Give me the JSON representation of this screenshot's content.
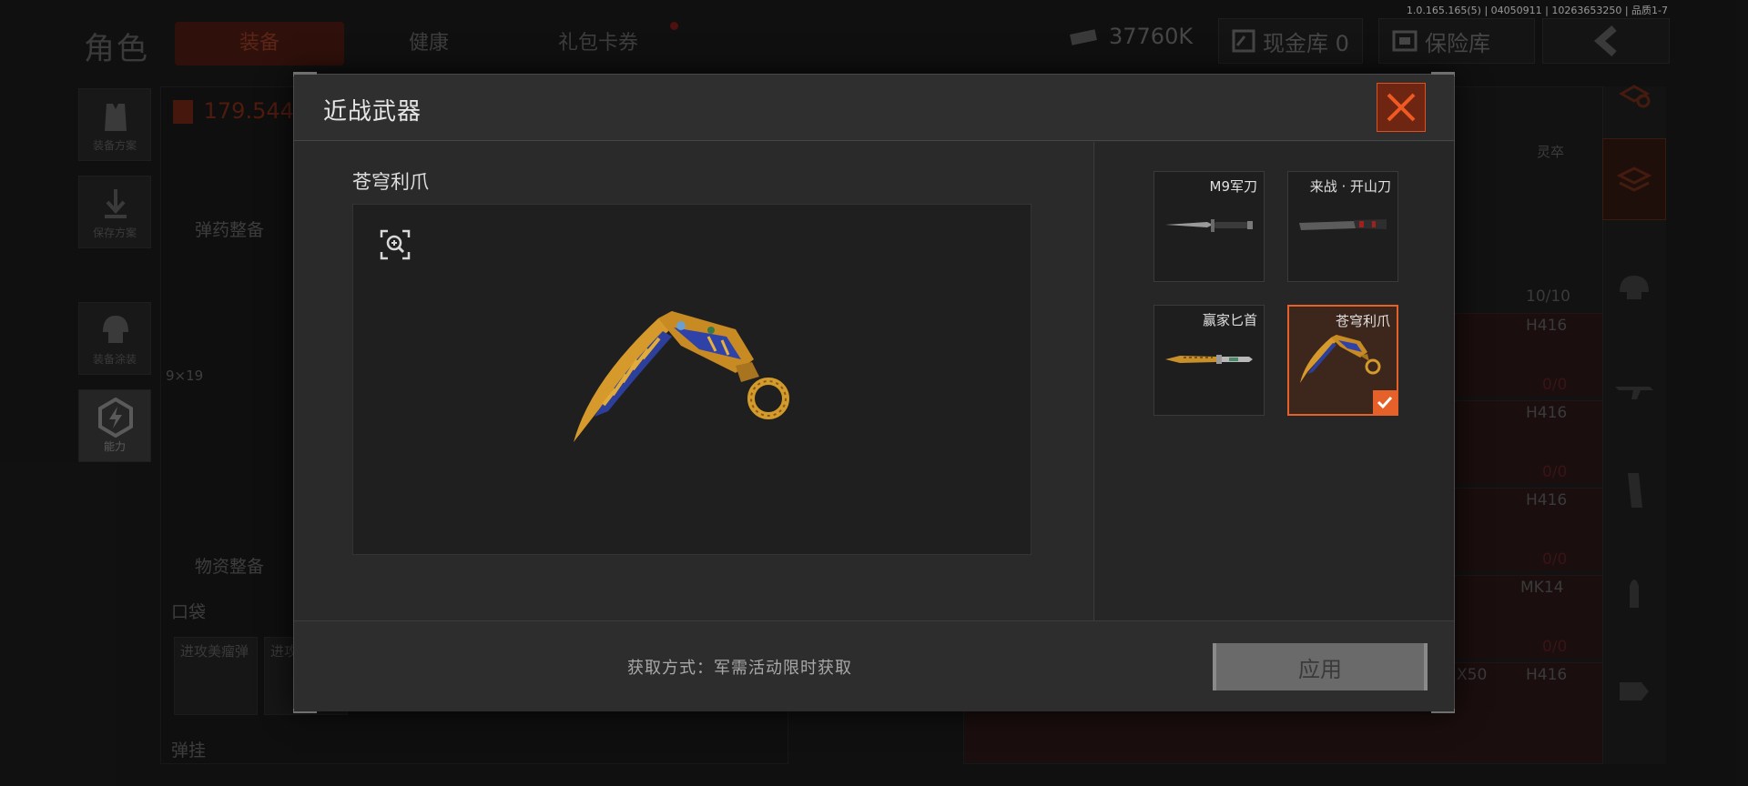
{
  "version": "1.0.165.165(5) | 04050911 | 10263653250 | 品质1-7",
  "background": {
    "title": "角色",
    "tabs": [
      "装备",
      "健康",
      "礼包卡券"
    ],
    "money": "37760K",
    "cash_vault": "现金库 0",
    "safe_box": "保险库",
    "weight": "179.544",
    "side_buttons": [
      "装备方案",
      "保存方案",
      "装备涂装",
      "能力"
    ],
    "ammo_label": "弹药整备",
    "supplies_label": "物资整备",
    "pocket_label": "口袋",
    "pocket_items": [
      "进攻美瘤弹",
      "进攻"
    ],
    "grenade_label": "弹挂",
    "ammo_size": "9×19",
    "right_header": "灵卒",
    "right_values": [
      "10/10",
      "H416",
      "0/0",
      "H416",
      "0/0",
      "H416",
      "0/0",
      "MK14",
      "0/0",
      "H416"
    ],
    "right_extra": "X50"
  },
  "modal": {
    "title": "近战武器",
    "selected_name": "苍穹利爪",
    "skins": [
      {
        "name": "M9军刀",
        "selected": false
      },
      {
        "name": "来战 · 开山刀",
        "selected": false
      },
      {
        "name": "赢家匕首",
        "selected": false
      },
      {
        "name": "苍穹利爪",
        "selected": true
      }
    ],
    "obtain": "获取方式：军需活动限时获取",
    "apply_label": "应用"
  },
  "colors": {
    "accent": "#e6602a",
    "close_bg": "#6e2612"
  }
}
